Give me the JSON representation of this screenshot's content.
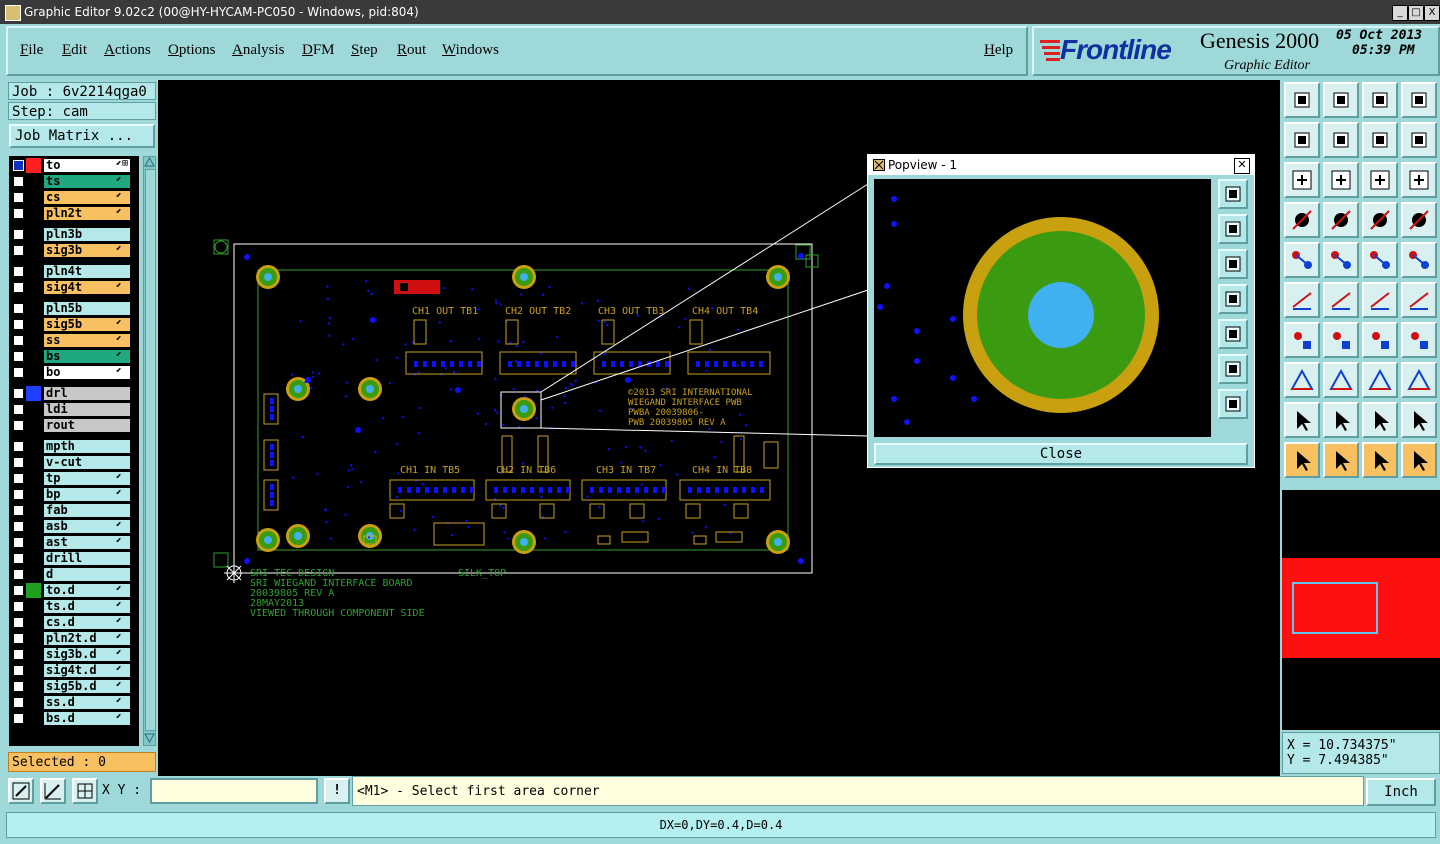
{
  "window": {
    "title": "Graphic Editor 9.02c2 (00@HY-HYCAM-PC050 - Windows, pid:804)",
    "controls": [
      "_",
      "□",
      "X"
    ]
  },
  "menu": {
    "items": [
      "File",
      "Edit",
      "Actions",
      "Options",
      "Analysis",
      "DFM",
      "Step",
      "Rout",
      "Windows"
    ],
    "help": "Help"
  },
  "brand": {
    "logo": "Frontline",
    "product": "Genesis 2000",
    "subtitle": "Graphic Editor",
    "date": "05 Oct 2013",
    "time": "05:39 PM"
  },
  "job": {
    "job_label": "Job : 6v2214qga0",
    "step_label": "Step: cam",
    "matrix_button": "Job Matrix ..."
  },
  "layers": [
    {
      "name": "to",
      "color": "#ffffff",
      "swatch": "#ff2020",
      "icon": "sel",
      "first": true
    },
    {
      "name": "ts",
      "color": "#20a880",
      "swatch": "",
      "icon": "edit"
    },
    {
      "name": "cs",
      "color": "#f8c060",
      "swatch": "",
      "icon": "edit"
    },
    {
      "name": "pln2t",
      "color": "#f8c060",
      "swatch": "",
      "icon": "edit"
    },
    {
      "name": "pln3b",
      "color": "#b5e8e8",
      "swatch": "",
      "icon": "",
      "gap": true
    },
    {
      "name": "sig3b",
      "color": "#f8c060",
      "swatch": "",
      "icon": "edit"
    },
    {
      "name": "pln4t",
      "color": "#b5e8e8",
      "swatch": "",
      "icon": "",
      "gap": true
    },
    {
      "name": "sig4t",
      "color": "#f8c060",
      "swatch": "",
      "icon": "edit"
    },
    {
      "name": "pln5b",
      "color": "#b5e8e8",
      "swatch": "",
      "icon": "",
      "gap": true
    },
    {
      "name": "sig5b",
      "color": "#f8c060",
      "swatch": "",
      "icon": "edit"
    },
    {
      "name": "ss",
      "color": "#f8c060",
      "swatch": "",
      "icon": "edit"
    },
    {
      "name": "bs",
      "color": "#20a880",
      "swatch": "",
      "icon": "edit"
    },
    {
      "name": "bo",
      "color": "#ffffff",
      "swatch": "",
      "icon": "edit"
    },
    {
      "name": "drl",
      "color": "#c8c8c8",
      "swatch": "#2040ff",
      "icon": "",
      "gap": true
    },
    {
      "name": "ldi",
      "color": "#c8c8c8",
      "swatch": "",
      "icon": ""
    },
    {
      "name": "rout",
      "color": "#c8c8c8",
      "swatch": "",
      "icon": ""
    },
    {
      "name": "mpth",
      "color": "#b5e8e8",
      "swatch": "",
      "icon": "",
      "gap": true
    },
    {
      "name": "v-cut",
      "color": "#b5e8e8",
      "swatch": "",
      "icon": ""
    },
    {
      "name": "tp",
      "color": "#b5e8e8",
      "swatch": "",
      "icon": "edit"
    },
    {
      "name": "bp",
      "color": "#b5e8e8",
      "swatch": "",
      "icon": "edit"
    },
    {
      "name": "fab",
      "color": "#b5e8e8",
      "swatch": "",
      "icon": ""
    },
    {
      "name": "asb",
      "color": "#b5e8e8",
      "swatch": "",
      "icon": "edit"
    },
    {
      "name": "ast",
      "color": "#b5e8e8",
      "swatch": "",
      "icon": "edit"
    },
    {
      "name": "drill",
      "color": "#b5e8e8",
      "swatch": "",
      "icon": ""
    },
    {
      "name": "d",
      "color": "#b5e8e8",
      "swatch": "",
      "icon": ""
    },
    {
      "name": "to.d",
      "color": "#b5e8e8",
      "swatch": "#20a020",
      "icon": "edit"
    },
    {
      "name": "ts.d",
      "color": "#b5e8e8",
      "swatch": "",
      "icon": "edit"
    },
    {
      "name": "cs.d",
      "color": "#b5e8e8",
      "swatch": "",
      "icon": "edit"
    },
    {
      "name": "pln2t.d",
      "color": "#b5e8e8",
      "swatch": "",
      "icon": "edit"
    },
    {
      "name": "sig3b.d",
      "color": "#b5e8e8",
      "swatch": "",
      "icon": "edit"
    },
    {
      "name": "sig4t.d",
      "color": "#b5e8e8",
      "swatch": "",
      "icon": "edit"
    },
    {
      "name": "sig5b.d",
      "color": "#b5e8e8",
      "swatch": "",
      "icon": "edit"
    },
    {
      "name": "ss.d",
      "color": "#b5e8e8",
      "swatch": "",
      "icon": "edit"
    },
    {
      "name": "bs.d",
      "color": "#b5e8e8",
      "swatch": "",
      "icon": "edit"
    }
  ],
  "selected": "Selected : 0",
  "board": {
    "connector_labels": [
      "CH1 OUT TB1",
      "CH2 OUT TB2",
      "CH3 OUT TB3",
      "CH4 OUT TB4",
      "CH1 IN TB5",
      "CH2 IN TB6",
      "CH3 IN TB7",
      "CH4 IN TB8"
    ],
    "info_lines": [
      "©2013 SRI INTERNATIONAL",
      "WIEGAND INTERFACE PWB",
      "PWBA 20039806-",
      "PWB 20039805 REV A"
    ],
    "footer_lines": [
      "SRI TEC DESIGN",
      "SRI WIEGAND INTERFACE BOARD",
      "20039805 REV A",
      "28MAY2013",
      "VIEWED THROUGH COMPONENT SIDE"
    ],
    "silk_label": "SILK_TOP"
  },
  "popview": {
    "title": "Popview - 1",
    "close_label": "Close"
  },
  "coords": {
    "x_label": "X = 10.734375\"",
    "y_label": "Y = 7.494385\""
  },
  "bottom": {
    "xy_label": "X Y :",
    "xy_value": "",
    "excl": "!",
    "prompt": "<M1> - Select first area corner",
    "units": "Inch"
  },
  "status": "DX=0,DY=0.4,D=0.4",
  "colors": {
    "bg": "#9ed8d8",
    "canvas": "#000000",
    "pad_outer": "#c8a010",
    "pad_mid": "#3a9a10",
    "pad_hole": "#40b0f0",
    "via": "#1010ff",
    "silk": "#c8a020",
    "outline": "#ffffff"
  }
}
